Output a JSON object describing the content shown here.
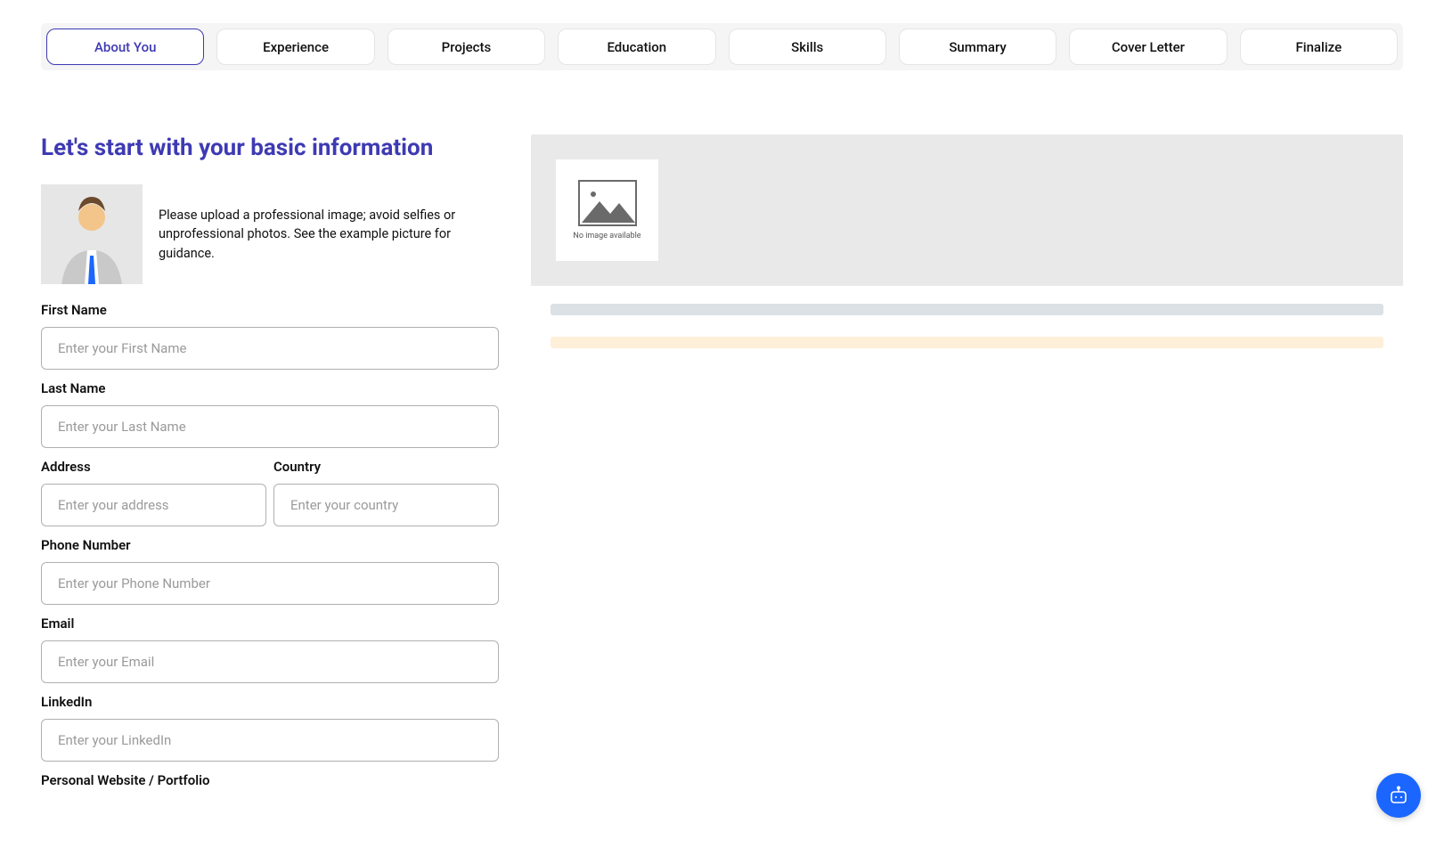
{
  "tabs": [
    {
      "label": "About You",
      "active": true
    },
    {
      "label": "Experience",
      "active": false
    },
    {
      "label": "Projects",
      "active": false
    },
    {
      "label": "Education",
      "active": false
    },
    {
      "label": "Skills",
      "active": false
    },
    {
      "label": "Summary",
      "active": false
    },
    {
      "label": "Cover Letter",
      "active": false
    },
    {
      "label": "Finalize",
      "active": false
    }
  ],
  "page": {
    "title": "Let's start with your basic information",
    "avatar_help": "Please upload a professional image; avoid selfies or unprofessional photos. See the example picture for guidance."
  },
  "form": {
    "first_name": {
      "label": "First Name",
      "placeholder": "Enter your First Name",
      "value": ""
    },
    "last_name": {
      "label": "Last Name",
      "placeholder": "Enter your Last Name",
      "value": ""
    },
    "address": {
      "label": "Address",
      "placeholder": "Enter your address",
      "value": ""
    },
    "country": {
      "label": "Country",
      "placeholder": "Enter your country",
      "value": ""
    },
    "phone": {
      "label": "Phone Number",
      "placeholder": "Enter your Phone Number",
      "value": ""
    },
    "email": {
      "label": "Email",
      "placeholder": "Enter your Email",
      "value": ""
    },
    "linkedin": {
      "label": "LinkedIn",
      "placeholder": "Enter your LinkedIn",
      "value": ""
    },
    "website": {
      "label": "Personal Website / Portfolio",
      "placeholder": "",
      "value": ""
    }
  },
  "preview": {
    "no_image_text": "No image available"
  }
}
